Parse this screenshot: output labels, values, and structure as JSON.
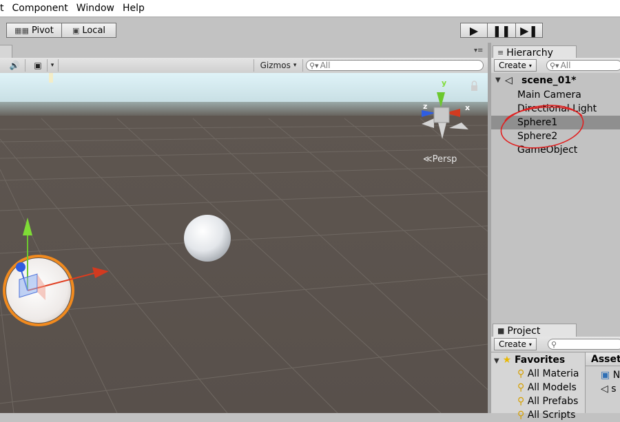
{
  "menu": [
    "t",
    "Component",
    "Window",
    "Help"
  ],
  "toolbar": {
    "pivot_label": "Pivot",
    "local_label": "Local",
    "play_icon": "play-icon",
    "pause_icon": "pause-icon",
    "step_icon": "step-icon"
  },
  "scene": {
    "gizmos_label": "Gizmos",
    "search_placeholder": "All",
    "persp_label": "Persp",
    "axis_x": "x",
    "axis_y": "y",
    "axis_z": "z"
  },
  "hierarchy": {
    "tab_label": "Hierarchy",
    "create_label": "Create",
    "search_placeholder": "All",
    "scene_name": "scene_01*",
    "items": [
      "Main Camera",
      "Directional Light",
      "Sphere1",
      "Sphere2",
      "GameObject"
    ],
    "selected_item": "Sphere1"
  },
  "project": {
    "tab_label": "Project",
    "create_label": "Create",
    "favorites_label": "Favorites",
    "favorites": [
      "All Materia",
      "All Models",
      "All Prefabs",
      "All Scripts"
    ],
    "assets_label": "Asset",
    "asset_items": [
      "N",
      "s"
    ]
  },
  "colors": {
    "editor_gray": "#c2c2c2",
    "ground": "#5a524c",
    "selection_outline": "#f18a1e",
    "annotation_red": "#e02020"
  }
}
